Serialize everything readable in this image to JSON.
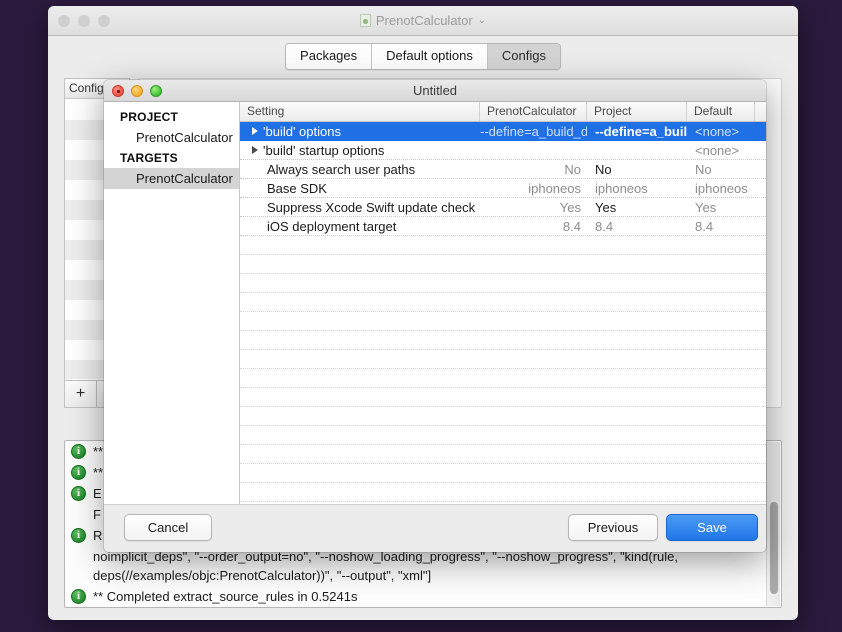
{
  "desktop": {
    "background": "#2b1a3d"
  },
  "main_window": {
    "title": "PrenotCalculator",
    "title_icon": "document-icon",
    "title_chevron": "⌄",
    "traffic_lights": [
      "close",
      "minimize",
      "zoom"
    ],
    "tabs": [
      {
        "label": "Packages",
        "selected": false
      },
      {
        "label": "Default options",
        "selected": false
      },
      {
        "label": "Configs",
        "selected": true
      }
    ],
    "configs_panel": {
      "header": "Configs",
      "add_button": "+"
    }
  },
  "modal": {
    "title": "Untitled",
    "traffic_lights": [
      "close",
      "minimize",
      "zoom"
    ],
    "sidebar": {
      "groups": [
        {
          "label": "PROJECT",
          "items": [
            {
              "label": "PrenotCalculator",
              "selected": false
            }
          ]
        },
        {
          "label": "TARGETS",
          "items": [
            {
              "label": "PrenotCalculator",
              "selected": true
            }
          ]
        }
      ]
    },
    "table": {
      "columns": [
        "Setting",
        "PrenotCalculator",
        "Project",
        "Default"
      ],
      "selection_color": "#1f6fe5",
      "rows": [
        {
          "setting": "'build' options",
          "expandable": true,
          "target": "--define=a_build_de",
          "project": "--define=a_build_",
          "default": "<none>",
          "selected": true,
          "target_stepper": false,
          "project_stepper": false
        },
        {
          "setting": "'build' startup options",
          "expandable": true,
          "target": "",
          "project": "",
          "default": "<none>",
          "selected": false,
          "target_stepper": false,
          "project_stepper": false
        },
        {
          "setting": "Always search user paths",
          "expandable": false,
          "target": "No",
          "project": "No",
          "default": "No",
          "selected": false,
          "target_stepper": true,
          "project_stepper": true
        },
        {
          "setting": "Base SDK",
          "expandable": false,
          "target": "iphoneos",
          "project": "iphoneos",
          "default": "iphoneos",
          "selected": false,
          "target_stepper": false,
          "project_stepper": false
        },
        {
          "setting": "Suppress Xcode Swift update check",
          "expandable": false,
          "target": "Yes",
          "project": "Yes",
          "default": "Yes",
          "selected": false,
          "target_stepper": true,
          "project_stepper": true
        },
        {
          "setting": "iOS deployment target",
          "expandable": false,
          "target": "8.4",
          "project": "8.4",
          "default": "8.4",
          "selected": false,
          "target_stepper": false,
          "project_stepper": false
        }
      ],
      "empty_row_count": 14
    },
    "footer": {
      "cancel_label": "Cancel",
      "previous_label": "Previous",
      "save_label": "Save",
      "save_accent": "#1f76e8"
    }
  },
  "console": {
    "lines": [
      {
        "icon": "info-icon",
        "text": "**",
        "wrapped": false
      },
      {
        "icon": "info-icon",
        "text": "**",
        "wrapped": false
      },
      {
        "icon": "info-icon",
        "text": "E",
        "wrapped": false
      },
      {
        "icon": null,
        "text": "F",
        "wrapped": false
      },
      {
        "icon": "info-icon",
        "text": "R",
        "wrapped": true
      },
      {
        "icon": null,
        "text": "noimplicit_deps\", \"--order_output=no\", \"--noshow_loading_progress\", \"--noshow_progress\", \"kind(rule, deps(//examples/objc:PrenotCalculator))\", \"--output\", \"xml\"]",
        "wrapped": true
      },
      {
        "icon": "info-icon",
        "text": "** Completed extract_source_rules in 0.5241s",
        "wrapped": false
      }
    ]
  }
}
